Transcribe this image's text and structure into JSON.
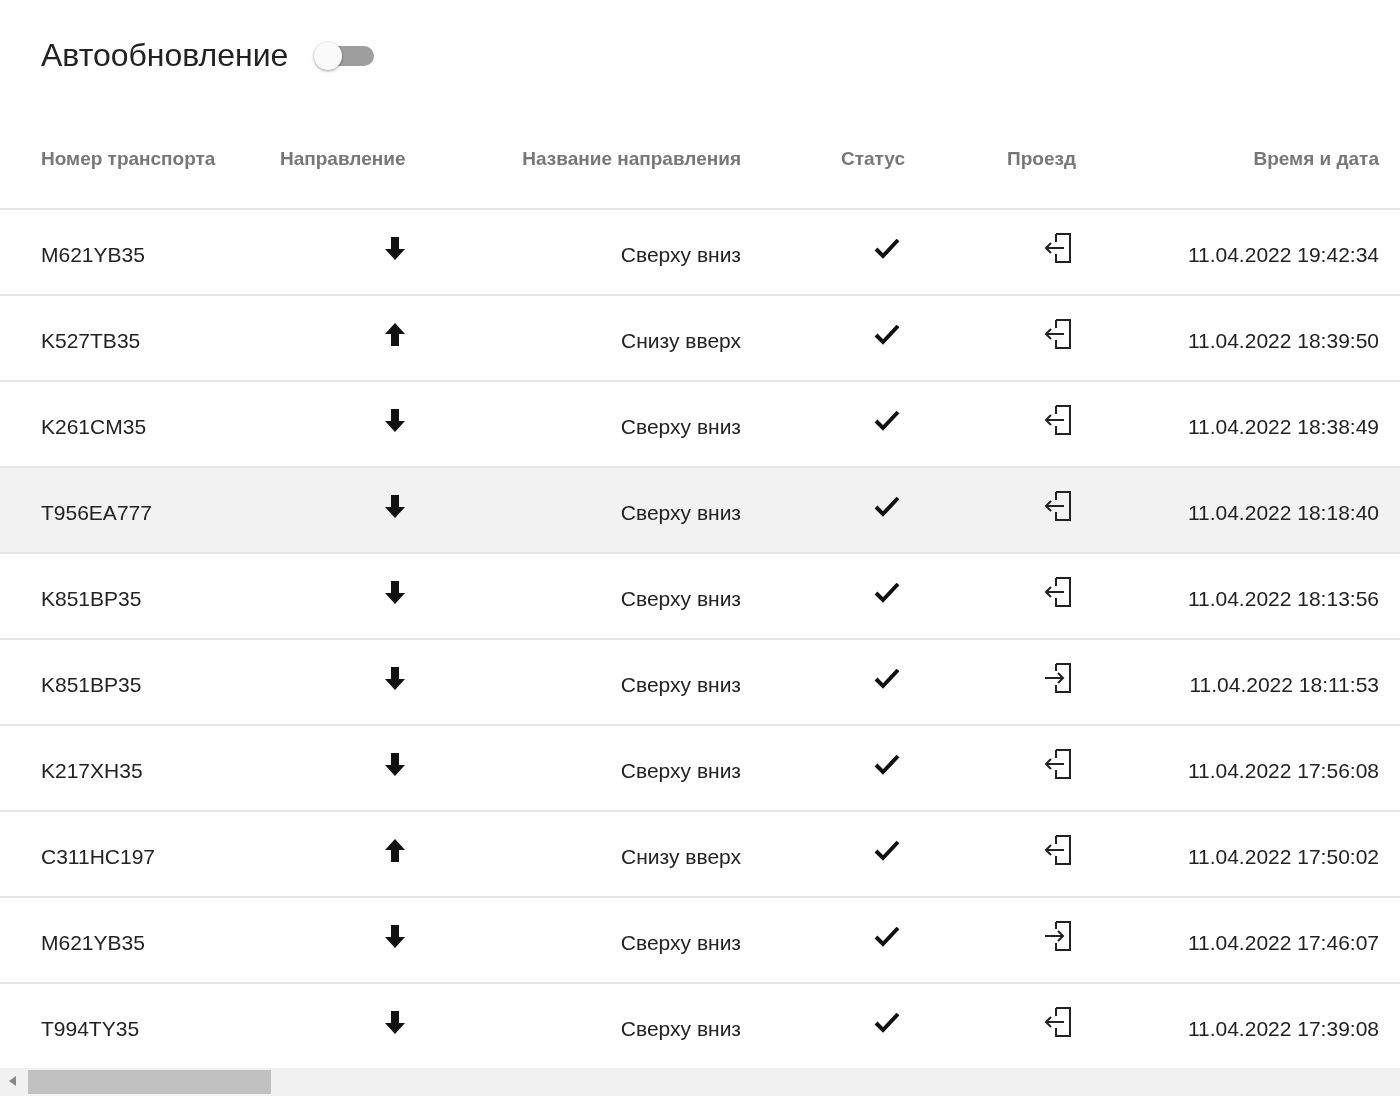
{
  "autoupdate": {
    "label": "Автообновление",
    "on": false
  },
  "table": {
    "columns": [
      "Номер транспорта",
      "Направление",
      "Название направления",
      "Статус",
      "Проезд",
      "Время и дата"
    ],
    "rows": [
      {
        "number": "M621YB35",
        "direction_icon": {
          "kind": "down"
        },
        "direction_name": "Сверху вниз",
        "status_icon": {
          "kind": "ok"
        },
        "passage_icon": {
          "kind": "exit"
        },
        "time": "11.04.2022 19:42:34",
        "selected": false
      },
      {
        "number": "K527TB35",
        "direction_icon": {
          "kind": "up"
        },
        "direction_name": "Снизу вверх",
        "status_icon": {
          "kind": "ok"
        },
        "passage_icon": {
          "kind": "exit"
        },
        "time": "11.04.2022 18:39:50",
        "selected": false
      },
      {
        "number": "K261CM35",
        "direction_icon": {
          "kind": "down"
        },
        "direction_name": "Сверху вниз",
        "status_icon": {
          "kind": "ok"
        },
        "passage_icon": {
          "kind": "exit"
        },
        "time": "11.04.2022 18:38:49",
        "selected": false
      },
      {
        "number": "T956EA777",
        "direction_icon": {
          "kind": "down"
        },
        "direction_name": "Сверху вниз",
        "status_icon": {
          "kind": "ok"
        },
        "passage_icon": {
          "kind": "exit"
        },
        "time": "11.04.2022 18:18:40",
        "selected": true
      },
      {
        "number": "K851BP35",
        "direction_icon": {
          "kind": "down"
        },
        "direction_name": "Сверху вниз",
        "status_icon": {
          "kind": "ok"
        },
        "passage_icon": {
          "kind": "exit"
        },
        "time": "11.04.2022 18:13:56",
        "selected": false
      },
      {
        "number": "K851BP35",
        "direction_icon": {
          "kind": "down"
        },
        "direction_name": "Сверху вниз",
        "status_icon": {
          "kind": "ok"
        },
        "passage_icon": {
          "kind": "enter"
        },
        "time": "11.04.2022 18:11:53",
        "selected": false
      },
      {
        "number": "K217XH35",
        "direction_icon": {
          "kind": "down"
        },
        "direction_name": "Сверху вниз",
        "status_icon": {
          "kind": "ok"
        },
        "passage_icon": {
          "kind": "exit"
        },
        "time": "11.04.2022 17:56:08",
        "selected": false
      },
      {
        "number": "C311HC197",
        "direction_icon": {
          "kind": "up"
        },
        "direction_name": "Снизу вверх",
        "status_icon": {
          "kind": "ok"
        },
        "passage_icon": {
          "kind": "exit"
        },
        "time": "11.04.2022 17:50:02",
        "selected": false
      },
      {
        "number": "M621YB35",
        "direction_icon": {
          "kind": "down"
        },
        "direction_name": "Сверху вниз",
        "status_icon": {
          "kind": "ok"
        },
        "passage_icon": {
          "kind": "enter"
        },
        "time": "11.04.2022 17:46:07",
        "selected": false
      },
      {
        "number": "T994TY35",
        "direction_icon": {
          "kind": "down"
        },
        "direction_name": "Сверху вниз",
        "status_icon": {
          "kind": "ok"
        },
        "passage_icon": {
          "kind": "exit"
        },
        "time": "11.04.2022 17:39:08",
        "selected": false
      }
    ]
  }
}
